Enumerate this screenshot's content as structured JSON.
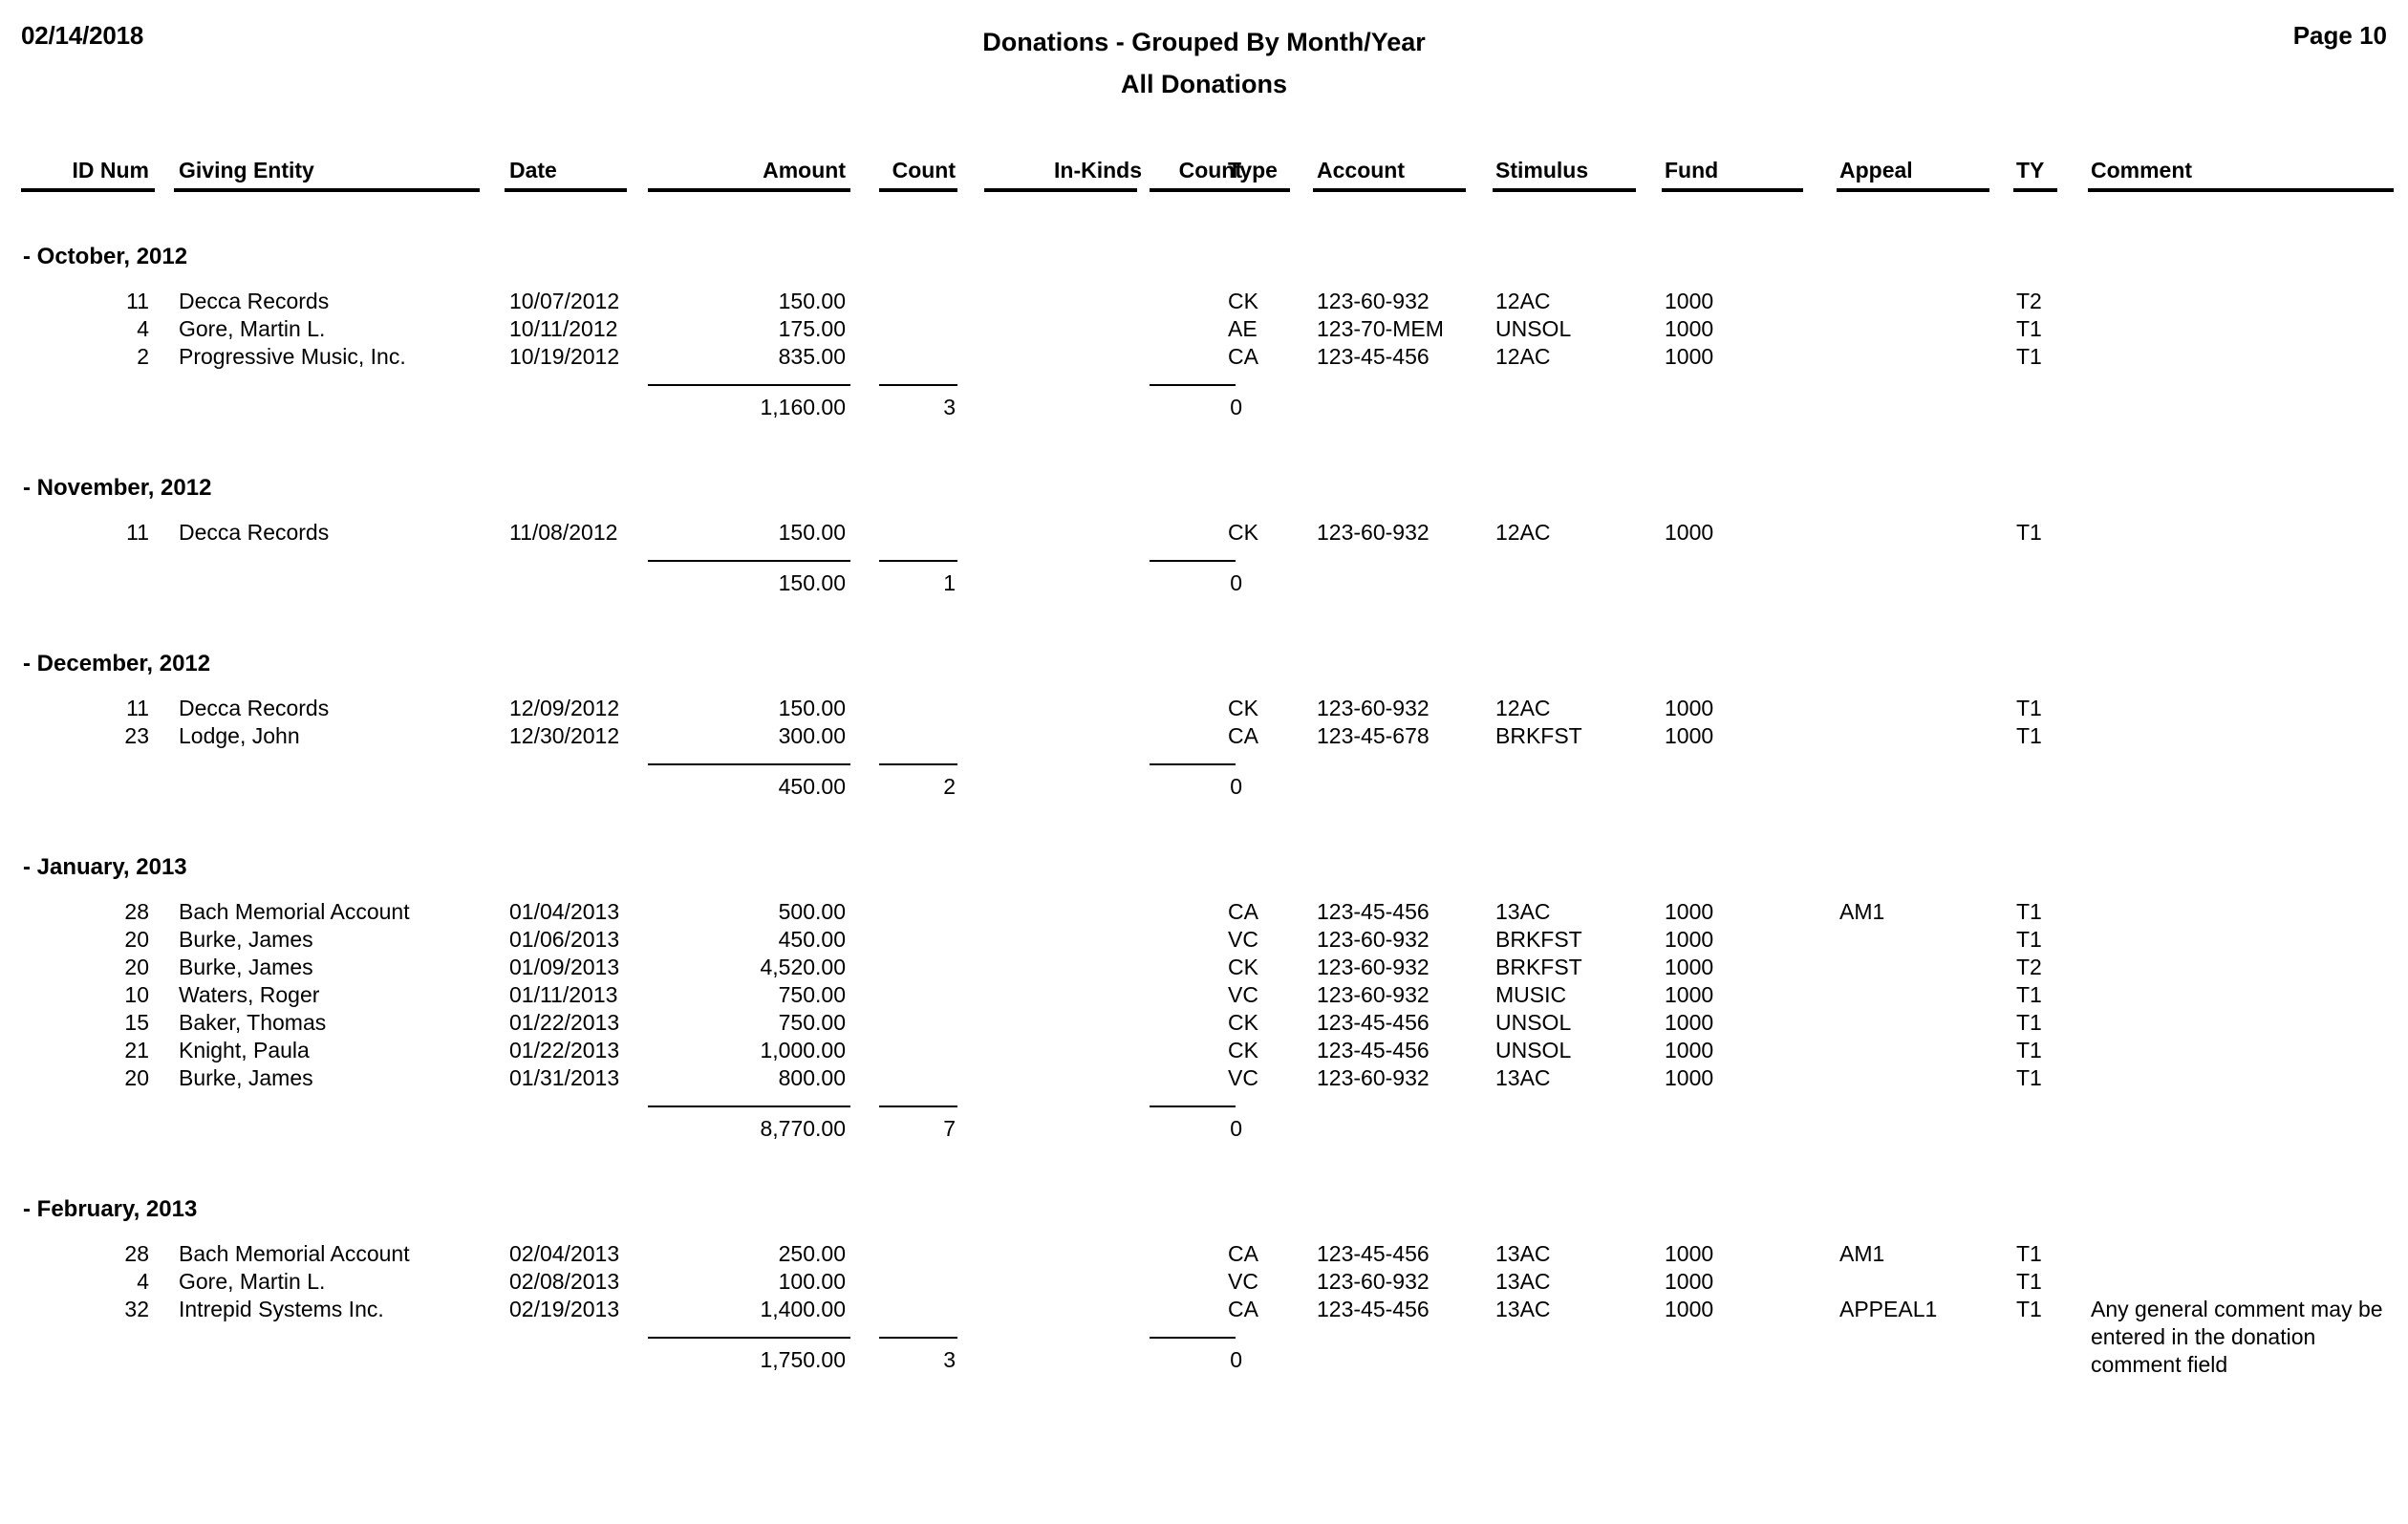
{
  "header": {
    "date": "02/14/2018",
    "title": "Donations - Grouped By Month/Year",
    "subtitle": "All Donations",
    "page_label": "Page 10"
  },
  "columns": {
    "id_num": "ID Num",
    "giving_entity": "Giving Entity",
    "date": "Date",
    "amount": "Amount",
    "count1": "Count",
    "in_kinds": "In-Kinds",
    "count2": "Count",
    "type": "Type",
    "account": "Account",
    "stimulus": "Stimulus",
    "fund": "Fund",
    "appeal": "Appeal",
    "ty": "TY",
    "comment": "Comment"
  },
  "groups": [
    {
      "title": "- October, 2012",
      "rows": [
        {
          "id": "11",
          "entity": "Decca Records",
          "date": "10/07/2012",
          "amount": "150.00",
          "count1": "",
          "inkinds": "",
          "count2": "",
          "type": "CK",
          "account": "123-60-932",
          "stimulus": "12AC",
          "fund": "1000",
          "appeal": "",
          "ty": "T2",
          "comment": ""
        },
        {
          "id": "4",
          "entity": "Gore, Martin L.",
          "date": "10/11/2012",
          "amount": "175.00",
          "count1": "",
          "inkinds": "",
          "count2": "",
          "type": "AE",
          "account": "123-70-MEM",
          "stimulus": "UNSOL",
          "fund": "1000",
          "appeal": "",
          "ty": "T1",
          "comment": ""
        },
        {
          "id": "2",
          "entity": "Progressive Music, Inc.",
          "date": "10/19/2012",
          "amount": "835.00",
          "count1": "",
          "inkinds": "",
          "count2": "",
          "type": "CA",
          "account": "123-45-456",
          "stimulus": "12AC",
          "fund": "1000",
          "appeal": "",
          "ty": "T1",
          "comment": ""
        }
      ],
      "subtotal": {
        "amount": "1,160.00",
        "count1": "3",
        "inkinds": "",
        "count2": "0"
      }
    },
    {
      "title": "- November, 2012",
      "rows": [
        {
          "id": "11",
          "entity": "Decca Records",
          "date": "11/08/2012",
          "amount": "150.00",
          "count1": "",
          "inkinds": "",
          "count2": "",
          "type": "CK",
          "account": "123-60-932",
          "stimulus": "12AC",
          "fund": "1000",
          "appeal": "",
          "ty": "T1",
          "comment": ""
        }
      ],
      "subtotal": {
        "amount": "150.00",
        "count1": "1",
        "inkinds": "",
        "count2": "0"
      }
    },
    {
      "title": "- December, 2012",
      "rows": [
        {
          "id": "11",
          "entity": "Decca Records",
          "date": "12/09/2012",
          "amount": "150.00",
          "count1": "",
          "inkinds": "",
          "count2": "",
          "type": "CK",
          "account": "123-60-932",
          "stimulus": "12AC",
          "fund": "1000",
          "appeal": "",
          "ty": "T1",
          "comment": ""
        },
        {
          "id": "23",
          "entity": "Lodge, John",
          "date": "12/30/2012",
          "amount": "300.00",
          "count1": "",
          "inkinds": "",
          "count2": "",
          "type": "CA",
          "account": "123-45-678",
          "stimulus": "BRKFST",
          "fund": "1000",
          "appeal": "",
          "ty": "T1",
          "comment": ""
        }
      ],
      "subtotal": {
        "amount": "450.00",
        "count1": "2",
        "inkinds": "",
        "count2": "0"
      }
    },
    {
      "title": "- January, 2013",
      "rows": [
        {
          "id": "28",
          "entity": "Bach Memorial Account",
          "date": "01/04/2013",
          "amount": "500.00",
          "count1": "",
          "inkinds": "",
          "count2": "",
          "type": "CA",
          "account": "123-45-456",
          "stimulus": "13AC",
          "fund": "1000",
          "appeal": "AM1",
          "ty": "T1",
          "comment": ""
        },
        {
          "id": "20",
          "entity": "Burke, James",
          "date": "01/06/2013",
          "amount": "450.00",
          "count1": "",
          "inkinds": "",
          "count2": "",
          "type": "VC",
          "account": "123-60-932",
          "stimulus": "BRKFST",
          "fund": "1000",
          "appeal": "",
          "ty": "T1",
          "comment": ""
        },
        {
          "id": "20",
          "entity": "Burke, James",
          "date": "01/09/2013",
          "amount": "4,520.00",
          "count1": "",
          "inkinds": "",
          "count2": "",
          "type": "CK",
          "account": "123-60-932",
          "stimulus": "BRKFST",
          "fund": "1000",
          "appeal": "",
          "ty": "T2",
          "comment": ""
        },
        {
          "id": "10",
          "entity": "Waters, Roger",
          "date": "01/11/2013",
          "amount": "750.00",
          "count1": "",
          "inkinds": "",
          "count2": "",
          "type": "VC",
          "account": "123-60-932",
          "stimulus": "MUSIC",
          "fund": "1000",
          "appeal": "",
          "ty": "T1",
          "comment": ""
        },
        {
          "id": "15",
          "entity": "Baker, Thomas",
          "date": "01/22/2013",
          "amount": "750.00",
          "count1": "",
          "inkinds": "",
          "count2": "",
          "type": "CK",
          "account": "123-45-456",
          "stimulus": "UNSOL",
          "fund": "1000",
          "appeal": "",
          "ty": "T1",
          "comment": ""
        },
        {
          "id": "21",
          "entity": "Knight, Paula",
          "date": "01/22/2013",
          "amount": "1,000.00",
          "count1": "",
          "inkinds": "",
          "count2": "",
          "type": "CK",
          "account": "123-45-456",
          "stimulus": "UNSOL",
          "fund": "1000",
          "appeal": "",
          "ty": "T1",
          "comment": ""
        },
        {
          "id": "20",
          "entity": "Burke, James",
          "date": "01/31/2013",
          "amount": "800.00",
          "count1": "",
          "inkinds": "",
          "count2": "",
          "type": "VC",
          "account": "123-60-932",
          "stimulus": "13AC",
          "fund": "1000",
          "appeal": "",
          "ty": "T1",
          "comment": ""
        }
      ],
      "subtotal": {
        "amount": "8,770.00",
        "count1": "7",
        "inkinds": "",
        "count2": "0"
      }
    },
    {
      "title": "- February, 2013",
      "rows": [
        {
          "id": "28",
          "entity": "Bach Memorial Account",
          "date": "02/04/2013",
          "amount": "250.00",
          "count1": "",
          "inkinds": "",
          "count2": "",
          "type": "CA",
          "account": "123-45-456",
          "stimulus": "13AC",
          "fund": "1000",
          "appeal": "AM1",
          "ty": "T1",
          "comment": ""
        },
        {
          "id": "4",
          "entity": "Gore, Martin L.",
          "date": "02/08/2013",
          "amount": "100.00",
          "count1": "",
          "inkinds": "",
          "count2": "",
          "type": "VC",
          "account": "123-60-932",
          "stimulus": "13AC",
          "fund": "1000",
          "appeal": "",
          "ty": "T1",
          "comment": ""
        },
        {
          "id": "32",
          "entity": "Intrepid Systems Inc.",
          "date": "02/19/2013",
          "amount": "1,400.00",
          "count1": "",
          "inkinds": "",
          "count2": "",
          "type": "CA",
          "account": "123-45-456",
          "stimulus": "13AC",
          "fund": "1000",
          "appeal": "APPEAL1",
          "ty": "T1",
          "comment": "Any general comment may be entered in the donation comment field"
        }
      ],
      "subtotal": {
        "amount": "1,750.00",
        "count1": "3",
        "inkinds": "",
        "count2": "0"
      }
    }
  ]
}
